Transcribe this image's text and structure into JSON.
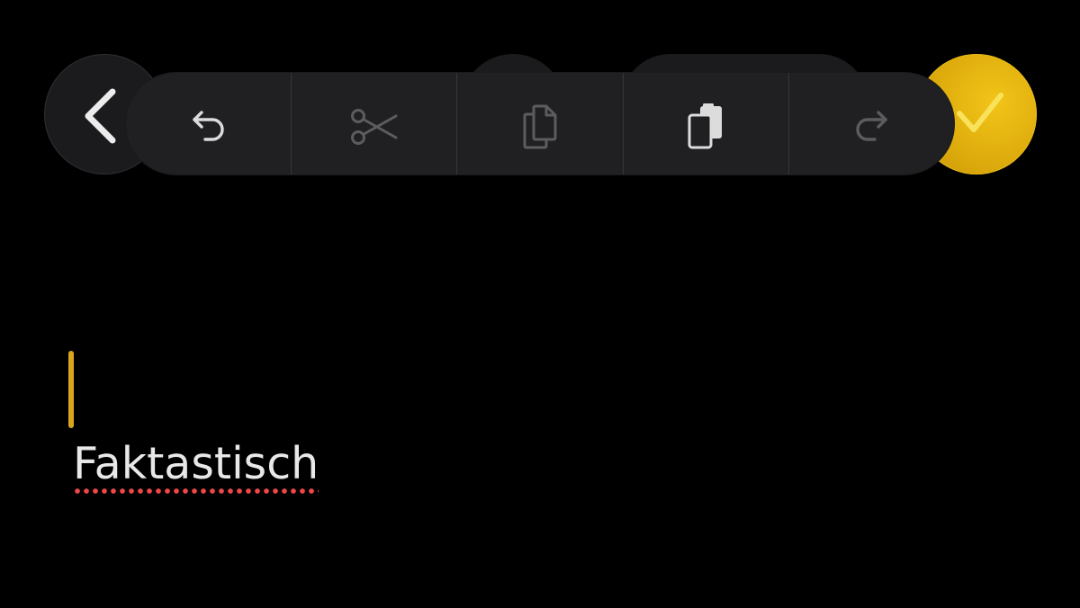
{
  "toolbar": {
    "tools": [
      {
        "id": "undo",
        "icon": "undo-icon",
        "enabled": true
      },
      {
        "id": "cut",
        "icon": "scissors-icon",
        "enabled": false
      },
      {
        "id": "copy",
        "icon": "copy-icon",
        "enabled": false
      },
      {
        "id": "paste",
        "icon": "paste-icon",
        "enabled": true
      },
      {
        "id": "redo",
        "icon": "redo-icon",
        "enabled": false
      }
    ]
  },
  "navigation": {
    "back_icon": "chevron-left-icon",
    "done_icon": "checkmark-icon"
  },
  "editor": {
    "text": "Faktastisch",
    "spellcheck_flag": "misspelled"
  },
  "colors": {
    "background": "#000000",
    "accent": "#e0ae10",
    "caret": "#d9a51c",
    "toolbar": "#202022",
    "icon_enabled": "#dcdcdc",
    "icon_disabled": "#5c5c60",
    "spellcheck": "#f04848"
  }
}
